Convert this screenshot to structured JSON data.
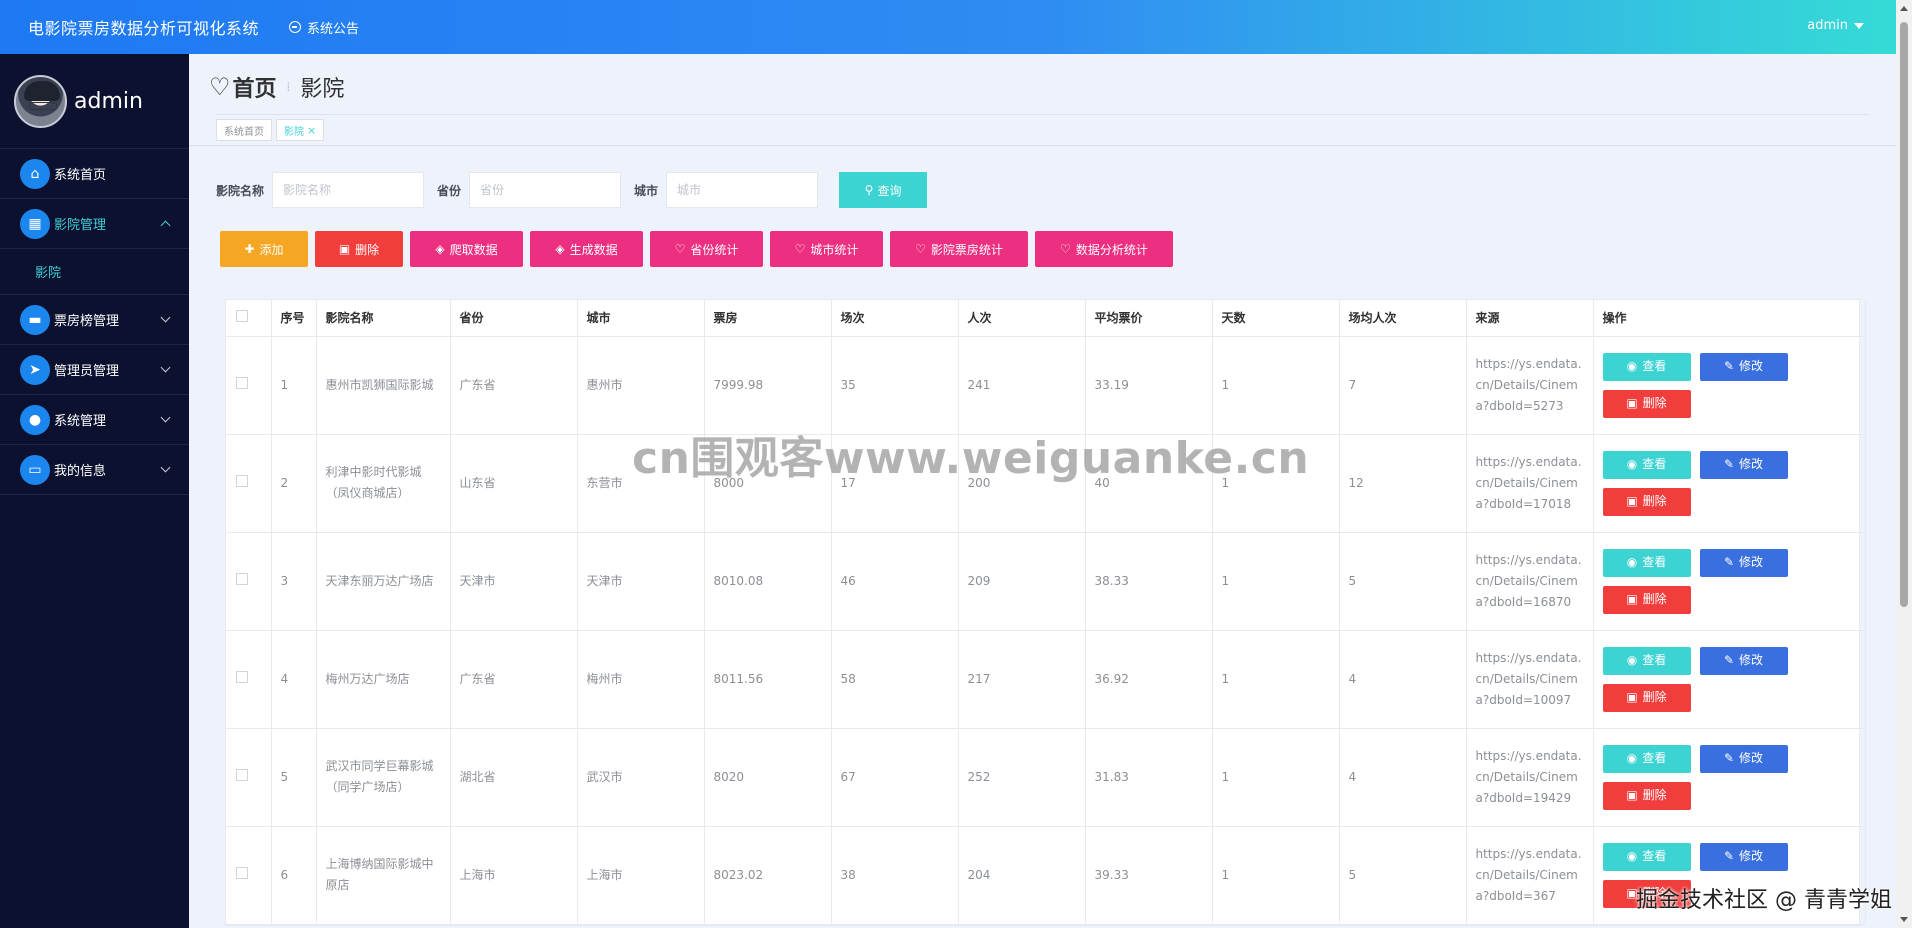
{
  "header": {
    "app_title": "电影院票房数据分析可视化系统",
    "notice_label": "系统公告",
    "user": "admin"
  },
  "sidebar": {
    "username": "admin",
    "items": [
      {
        "label": "系统首页",
        "icon": "home-icon"
      },
      {
        "label": "影院管理",
        "icon": "grid-icon",
        "expanded": true,
        "children": [
          {
            "label": "影院"
          }
        ]
      },
      {
        "label": "票房榜管理",
        "icon": "ticket-icon"
      },
      {
        "label": "管理员管理",
        "icon": "send-icon"
      },
      {
        "label": "系统管理",
        "icon": "user-icon"
      },
      {
        "label": "我的信息",
        "icon": "card-icon"
      }
    ]
  },
  "page": {
    "crumb_home": "首页",
    "crumb_current": "影院",
    "tags": [
      "系统首页",
      "影院"
    ]
  },
  "search": {
    "name_label": "影院名称",
    "name_placeholder": "影院名称",
    "province_label": "省份",
    "province_placeholder": "省份",
    "city_label": "城市",
    "city_placeholder": "城市",
    "query_label": "查询"
  },
  "toolbar": {
    "add": "添加",
    "delete": "删除",
    "crawl": "爬取数据",
    "generate": "生成数据",
    "province_stats": "省份统计",
    "city_stats": "城市统计",
    "boxoffice_stats": "影院票房统计",
    "analysis_stats": "数据分析统计"
  },
  "table": {
    "columns": [
      "序号",
      "影院名称",
      "省份",
      "城市",
      "票房",
      "场次",
      "人次",
      "平均票价",
      "天数",
      "场均人次",
      "来源",
      "操作"
    ],
    "actions": {
      "view": "查看",
      "edit": "修改",
      "delete": "删除"
    },
    "rows": [
      {
        "no": "1",
        "name": "惠州市凯狮国际影城",
        "province": "广东省",
        "city": "惠州市",
        "boxoffice": "7999.98",
        "shows": "35",
        "viewers": "241",
        "avg_price": "33.19",
        "days": "1",
        "avg_viewers": "7",
        "source": "https://ys.endata.cn/Details/Cinema?dboId=5273"
      },
      {
        "no": "2",
        "name": "利津中影时代影城（凤仪商城店）",
        "province": "山东省",
        "city": "东营市",
        "boxoffice": "8000",
        "shows": "17",
        "viewers": "200",
        "avg_price": "40",
        "days": "1",
        "avg_viewers": "12",
        "source": "https://ys.endata.cn/Details/Cinema?dboId=17018"
      },
      {
        "no": "3",
        "name": "天津东丽万达广场店",
        "province": "天津市",
        "city": "天津市",
        "boxoffice": "8010.08",
        "shows": "46",
        "viewers": "209",
        "avg_price": "38.33",
        "days": "1",
        "avg_viewers": "5",
        "source": "https://ys.endata.cn/Details/Cinema?dboId=16870"
      },
      {
        "no": "4",
        "name": "梅州万达广场店",
        "province": "广东省",
        "city": "梅州市",
        "boxoffice": "8011.56",
        "shows": "58",
        "viewers": "217",
        "avg_price": "36.92",
        "days": "1",
        "avg_viewers": "4",
        "source": "https://ys.endata.cn/Details/Cinema?dboId=10097"
      },
      {
        "no": "5",
        "name": "武汉市同学巨幕影城（同学广场店）",
        "province": "湖北省",
        "city": "武汉市",
        "boxoffice": "8020",
        "shows": "67",
        "viewers": "252",
        "avg_price": "31.83",
        "days": "1",
        "avg_viewers": "4",
        "source": "https://ys.endata.cn/Details/Cinema?dboId=19429"
      },
      {
        "no": "6",
        "name": "上海博纳国际影城中原店",
        "province": "上海市",
        "city": "上海市",
        "boxoffice": "8023.02",
        "shows": "38",
        "viewers": "204",
        "avg_price": "39.33",
        "days": "1",
        "avg_viewers": "5",
        "source": "https://ys.endata.cn/Details/Cinema?dboId=367"
      }
    ]
  },
  "watermark": "cn围观客www.weiguanke.cn",
  "corner_watermark": "掘金技术社区 @ 青青学姐",
  "colors": {
    "sidebar_bg": "#0c1130",
    "accent_teal": "#3dd3d3",
    "pink": "#ec2f80",
    "red": "#f23d3d",
    "orange": "#f5a623",
    "blue": "#3a6fe0"
  }
}
